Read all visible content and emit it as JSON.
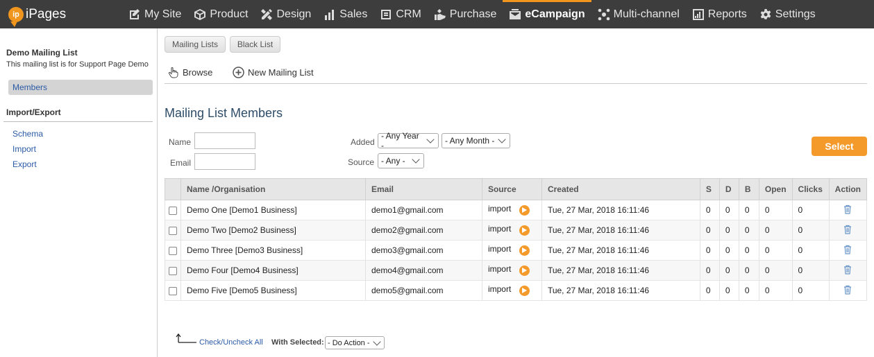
{
  "app": {
    "logo_badge": "ip",
    "logo_name": "iPages"
  },
  "nav": [
    {
      "key": "my-site",
      "label": "My Site",
      "icon": "edit-icon"
    },
    {
      "key": "product",
      "label": "Product",
      "icon": "box-icon"
    },
    {
      "key": "design",
      "label": "Design",
      "icon": "pencil-ruler-icon"
    },
    {
      "key": "sales",
      "label": "Sales",
      "icon": "bar-chart-icon"
    },
    {
      "key": "crm",
      "label": "CRM",
      "icon": "contact-card-icon"
    },
    {
      "key": "purchase",
      "label": "Purchase",
      "icon": "hand-icon"
    },
    {
      "key": "ecampaign",
      "label": "eCampaign",
      "icon": "envelope-icon",
      "active": true
    },
    {
      "key": "multi-channel",
      "label": "Multi-channel",
      "icon": "network-icon"
    },
    {
      "key": "reports",
      "label": "Reports",
      "icon": "reports-icon"
    },
    {
      "key": "settings",
      "label": "Settings",
      "icon": "gear-icon"
    }
  ],
  "sidebar": {
    "list_title": "Demo Mailing List",
    "list_desc": "This mailing list is for Support Page Demo",
    "members": "Members",
    "import_export_title": "Import/Export",
    "links": [
      "Schema",
      "Import",
      "Export"
    ]
  },
  "tabs": {
    "mailing_lists": "Mailing Lists",
    "black_list": "Black List"
  },
  "toolbar": {
    "browse": "Browse",
    "new_list": "New Mailing List"
  },
  "page_title": "Mailing List Members",
  "filters": {
    "name_label": "Name",
    "email_label": "Email",
    "added_label": "Added",
    "source_label": "Source",
    "year": "- Any Year -",
    "month": "- Any Month -",
    "source": "- Any -",
    "select_button": "Select"
  },
  "table": {
    "headers": [
      "Name /Organisation",
      "Email",
      "Source",
      "Created",
      "S",
      "D",
      "B",
      "Open",
      "Clicks",
      "Action"
    ],
    "rows": [
      {
        "name": "Demo One [Demo1 Business]",
        "email": "demo1@gmail.com",
        "source": "import",
        "created": "Tue, 27 Mar, 2018 16:11:46",
        "s": "0",
        "d": "0",
        "b": "0",
        "open": "0",
        "clicks": "0"
      },
      {
        "name": "Demo Two [Demo2 Business]",
        "email": "demo2@gmail.com",
        "source": "import",
        "created": "Tue, 27 Mar, 2018 16:11:46",
        "s": "0",
        "d": "0",
        "b": "0",
        "open": "0",
        "clicks": "0"
      },
      {
        "name": "Demo Three [Demo3 Business]",
        "email": "demo3@gmail.com",
        "source": "import",
        "created": "Tue, 27 Mar, 2018 16:11:46",
        "s": "0",
        "d": "0",
        "b": "0",
        "open": "0",
        "clicks": "0"
      },
      {
        "name": "Demo Four [Demo4 Business]",
        "email": "demo4@gmail.com",
        "source": "import",
        "created": "Tue, 27 Mar, 2018 16:11:46",
        "s": "0",
        "d": "0",
        "b": "0",
        "open": "0",
        "clicks": "0"
      },
      {
        "name": "Demo Five [Demo5 Business]",
        "email": "demo5@gmail.com",
        "source": "import",
        "created": "Tue, 27 Mar, 2018 16:11:46",
        "s": "0",
        "d": "0",
        "b": "0",
        "open": "0",
        "clicks": "0"
      }
    ]
  },
  "footer": {
    "check_all": "Check/Uncheck All",
    "with_selected": "With Selected:",
    "action": "- Do Action -"
  },
  "colors": {
    "accent": "#f39a2b",
    "topbar": "#3d3d3d",
    "link": "#2b5aa6",
    "title": "#2e4d68"
  }
}
